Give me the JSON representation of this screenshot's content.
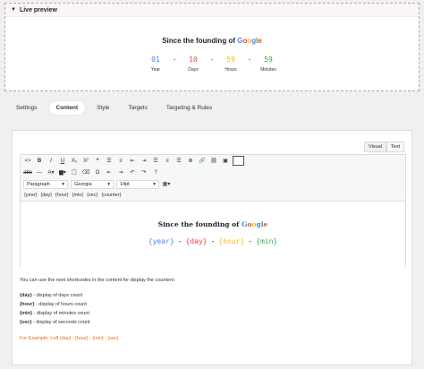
{
  "preview": {
    "title": "Live preview",
    "heading_prefix": "Since the founding of ",
    "brand_letters": [
      "G",
      "o",
      "o",
      "g",
      "l",
      "e"
    ],
    "counter": [
      {
        "value": "01",
        "label": "Year",
        "color": "#4285f4"
      },
      {
        "value": "10",
        "label": "Days",
        "color": "#ea4335"
      },
      {
        "value": "59",
        "label": "Hours",
        "color": "#fbbc05"
      },
      {
        "value": "59",
        "label": "Minutes",
        "color": "#34a853"
      }
    ],
    "separator": "-"
  },
  "tabs": [
    "Settings",
    "Content",
    "Style",
    "Targets",
    "Targeting & Rules"
  ],
  "active_tab": "Content",
  "editor": {
    "mode_tabs": [
      "Visual",
      "Text"
    ],
    "format_select": "Paragraph",
    "font_select": "Georgia",
    "size_select": "14pt",
    "shortcodes": [
      "{year}",
      "{day}",
      "{hour}",
      "{min}",
      "{sec}",
      "{counter}"
    ],
    "content_prefix": "Since the founding of ",
    "content_codes": [
      {
        "text": "{year}",
        "color": "#4285f4"
      },
      {
        "text": "{day}",
        "color": "#ea4335"
      },
      {
        "text": "{hour}",
        "color": "#fbbc05"
      },
      {
        "text": "{min}",
        "color": "#34a853"
      }
    ],
    "code_separator": "-"
  },
  "help": {
    "intro": "You can use the next shortcodes in the content for display the counters:",
    "items": [
      {
        "code": "{day}",
        "desc": " - display of days count"
      },
      {
        "code": "{hour}",
        "desc": " - display of hours count"
      },
      {
        "code": "{min}",
        "desc": " - display of minutes count"
      },
      {
        "code": "{sec}",
        "desc": " - display of seconds count"
      }
    ],
    "example": "For Example: Left {day} : {hour} : {min} : {sec}"
  }
}
